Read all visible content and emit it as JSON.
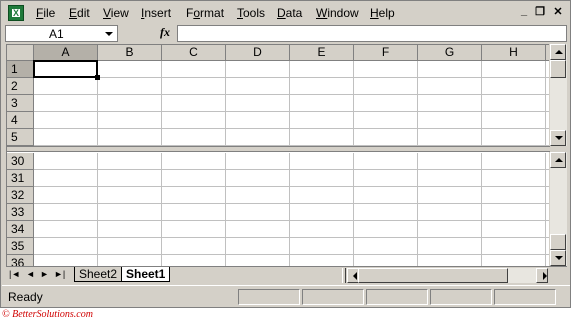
{
  "menu": {
    "items": [
      "File",
      "Edit",
      "View",
      "Insert",
      "Format",
      "Tools",
      "Data",
      "Window",
      "Help"
    ],
    "mnemonics": [
      "F",
      "E",
      "V",
      "I",
      "o",
      "T",
      "D",
      "W",
      "H"
    ]
  },
  "window_controls": {
    "minimize": "_",
    "restore": "❐",
    "close": "✕"
  },
  "formula_bar": {
    "name_box": "A1",
    "fx_label": "fx",
    "formula": ""
  },
  "columns": [
    "A",
    "B",
    "C",
    "D",
    "E",
    "F",
    "G",
    "H"
  ],
  "active_column": "A",
  "top_pane_rows": [
    "1",
    "2",
    "3",
    "4",
    "5"
  ],
  "bottom_pane_rows": [
    "30",
    "31",
    "32",
    "33",
    "34",
    "35",
    "36"
  ],
  "active_cell": "A1",
  "sheet_tabs": [
    {
      "label": "Sheet2",
      "active": false
    },
    {
      "label": "Sheet1",
      "active": true
    }
  ],
  "tab_nav": [
    "|◄",
    "◄",
    "►",
    "►|"
  ],
  "status": {
    "text": "Ready"
  },
  "credit": "© BetterSolutions.com",
  "colors": {
    "chrome": "#d4d0c8",
    "header_active": "#b4b0a8",
    "credit": "#d00000"
  }
}
